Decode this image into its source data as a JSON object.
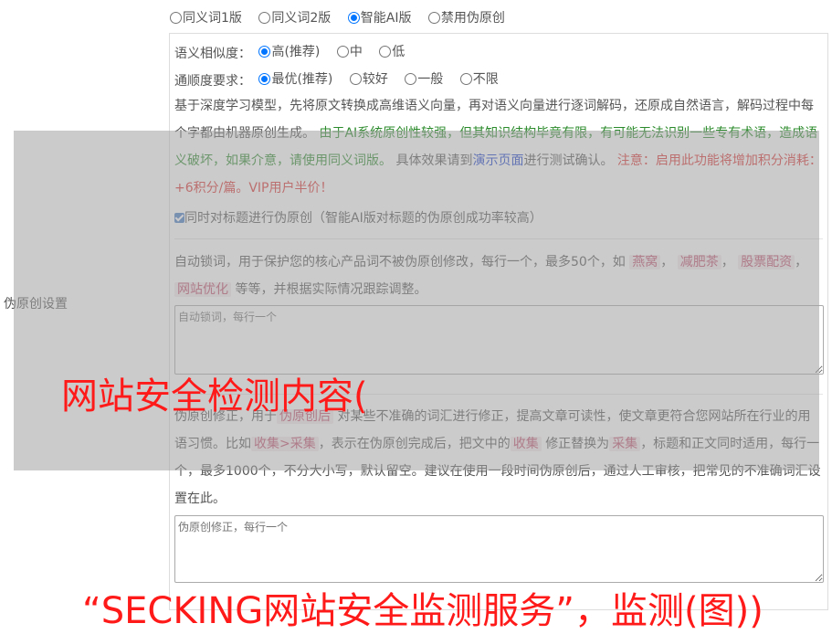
{
  "version_options": [
    {
      "label": "同义词1版",
      "selected": false
    },
    {
      "label": "同义词2版",
      "selected": false
    },
    {
      "label": "智能AI版",
      "selected": true
    },
    {
      "label": "禁用伪原创",
      "selected": false
    }
  ],
  "side_label": "伪原创设置",
  "similarity": {
    "label": "语义相似度：",
    "options": [
      {
        "label": "高(推荐)",
        "selected": true
      },
      {
        "label": "中",
        "selected": false
      },
      {
        "label": "低",
        "selected": false
      }
    ]
  },
  "fluency": {
    "label": "通顺度要求：",
    "options": [
      {
        "label": "最优(推荐)",
        "selected": true
      },
      {
        "label": "较好",
        "selected": false
      },
      {
        "label": "一般",
        "selected": false
      },
      {
        "label": "不限",
        "selected": false
      }
    ]
  },
  "description": {
    "part1": "基于深度学习模型，先将原文转换成高维语义向量，再对语义向量进行逐词解码，还原成自然语言，解码过程中每个字都由机器原创生成。",
    "warning_green": "由于AI系统原创性较强，但其知识结构毕竟有限，有可能无法识别一些专有术语，造成语义破坏，如果介意，请使用同义词版。",
    "part2": "具体效果请到",
    "demo_link": "演示页面",
    "part3": "进行测试确认。",
    "notice_red": "注意：启用此功能将增加积分消耗：+6积分/篇。VIP用户半价！"
  },
  "title_checkbox": {
    "label": "同时对标题进行伪原创（智能AI版对标题的伪原创成功率较高）",
    "checked": true
  },
  "lock_words": {
    "desc_a": "自动锁词，用于保护您的核心产品词不被伪原创修改，每行一个，最多50个，如",
    "examples": [
      "燕窝",
      "减肥茶",
      "股票配资",
      "网站优化"
    ],
    "desc_b": "等等，并根据实际情况跟踪调整。",
    "placeholder": "自动锁词，每行一个"
  },
  "corrections": {
    "desc_a": "伪原创修正，用于",
    "tag1": "伪原创后",
    "desc_b": "对某些不准确的词汇进行修正，提高文章可读性，使文章更符合您网站所在行业的用语习惯。比如",
    "tag2": "收集>采集",
    "desc_c": "，表示在伪原创完成后，把文中的",
    "tag3": "收集",
    "desc_d": "修正替换为",
    "tag4": "采集",
    "desc_e": "，标题和正文同时适用，每行一个，最多1000个，不分大小写，默认留空。建议在使用一段时间伪原创后，通过人工审核，把常见的不准确词汇设置在此。",
    "placeholder": "伪原创修正，每行一个"
  },
  "watermark": {
    "line1": "网站安全检测内容(",
    "line2": "“SECKING网站安全监测服务”，监测(图))"
  },
  "colors": {
    "accent": "#0075ff",
    "green_text": "#2b8a2b",
    "red_text": "#dd3333",
    "link": "#1a3fcc",
    "overlay": "#a0a0a0"
  }
}
